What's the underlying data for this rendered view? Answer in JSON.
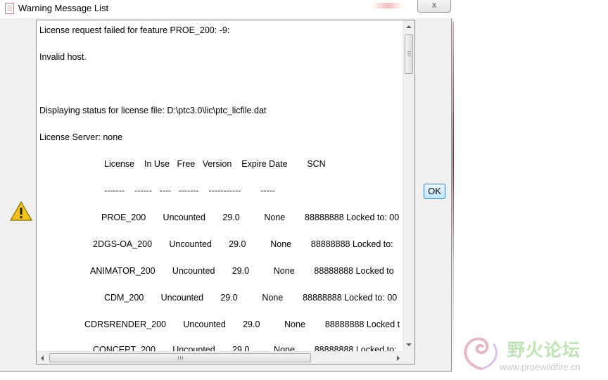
{
  "window": {
    "title": "Warning Message List",
    "close_label": "x"
  },
  "message_lines": [
    "License request failed for feature PROE_200: -9:",
    "Invalid host.",
    "Displaying status for license file: D:\\ptc3.0\\lic\\ptc_licfile.dat",
    "License Server: none",
    "License    In Use   Free   Version    Expire Date        SCN",
    "-------    ------   ----   -------    -----------        -----",
    "PROE_200       Uncounted       29.0          None        88888888 Locked to: 00",
    "2DGS-OA_200       Uncounted       29.0          None        88888888 Locked to:",
    "ANIMATOR_200       Uncounted       29.0          None        88888888 Locked to",
    "CDM_200       Uncounted       29.0          None        88888888 Locked to: 00",
    "CDRSRENDER_200       Uncounted       29.0          None        88888888 Locked t",
    "CONCEPT_200       Uncounted       29.0          None        88888888 Locked to:"
  ],
  "buttons": {
    "ok_label": "OK"
  },
  "scrollbars": {
    "vertical_position": 0.0,
    "horizontal_position": 0.0
  },
  "watermark": {
    "name": "野火论坛",
    "url": "www.proewildfire.cn"
  },
  "icons": {
    "title": "document-icon",
    "warning": "warning-triangle-icon"
  },
  "colors": {
    "warning_yellow": "#f3c21b",
    "ok_border": "#3c7fb1",
    "watermark_green": "#bfe3b2"
  }
}
